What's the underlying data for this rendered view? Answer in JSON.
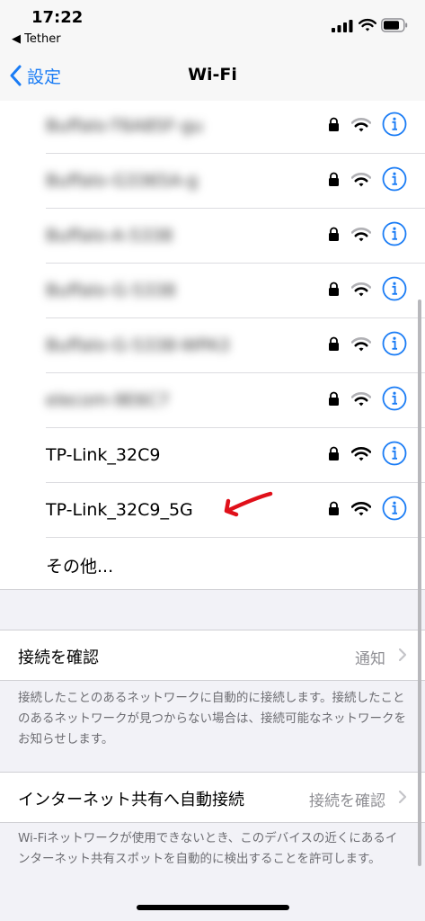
{
  "status_bar": {
    "time": "17:22",
    "back_app": "◀ Tether"
  },
  "nav": {
    "back_label": "設定",
    "title": "Wi-Fi"
  },
  "networks": [
    {
      "name": "Buffalo-T6A85F-gu",
      "blurred": true
    },
    {
      "name": "Buffalo-G3365A-g",
      "blurred": true
    },
    {
      "name": "Buffalo-A-5338",
      "blurred": true
    },
    {
      "name": "Buffalo-G-5338",
      "blurred": true
    },
    {
      "name": "Buffalo-G-5338-WPA3",
      "blurred": true
    },
    {
      "name": "elecom-9E6C7",
      "blurred": true
    },
    {
      "name": "TP-Link_32C9",
      "blurred": false
    },
    {
      "name": "TP-Link_32C9_5G",
      "blurred": false
    }
  ],
  "other_label": "その他...",
  "ask_to_join": {
    "label": "接続を確認",
    "value": "通知",
    "footer": "接続したことのあるネットワークに自動的に接続します。接続したことのあるネットワークが見つからない場合は、接続可能なネットワークをお知らせします。"
  },
  "auto_join_hotspot": {
    "label": "インターネット共有へ自動接続",
    "value": "接続を確認",
    "footer": "Wi-Fiネットワークが使用できないとき、このデバイスの近くにあるインターネット共有スポットを自動的に検出することを許可します。"
  },
  "colors": {
    "accent": "#1a7cf5",
    "annotation_arrow": "#e0101a"
  }
}
